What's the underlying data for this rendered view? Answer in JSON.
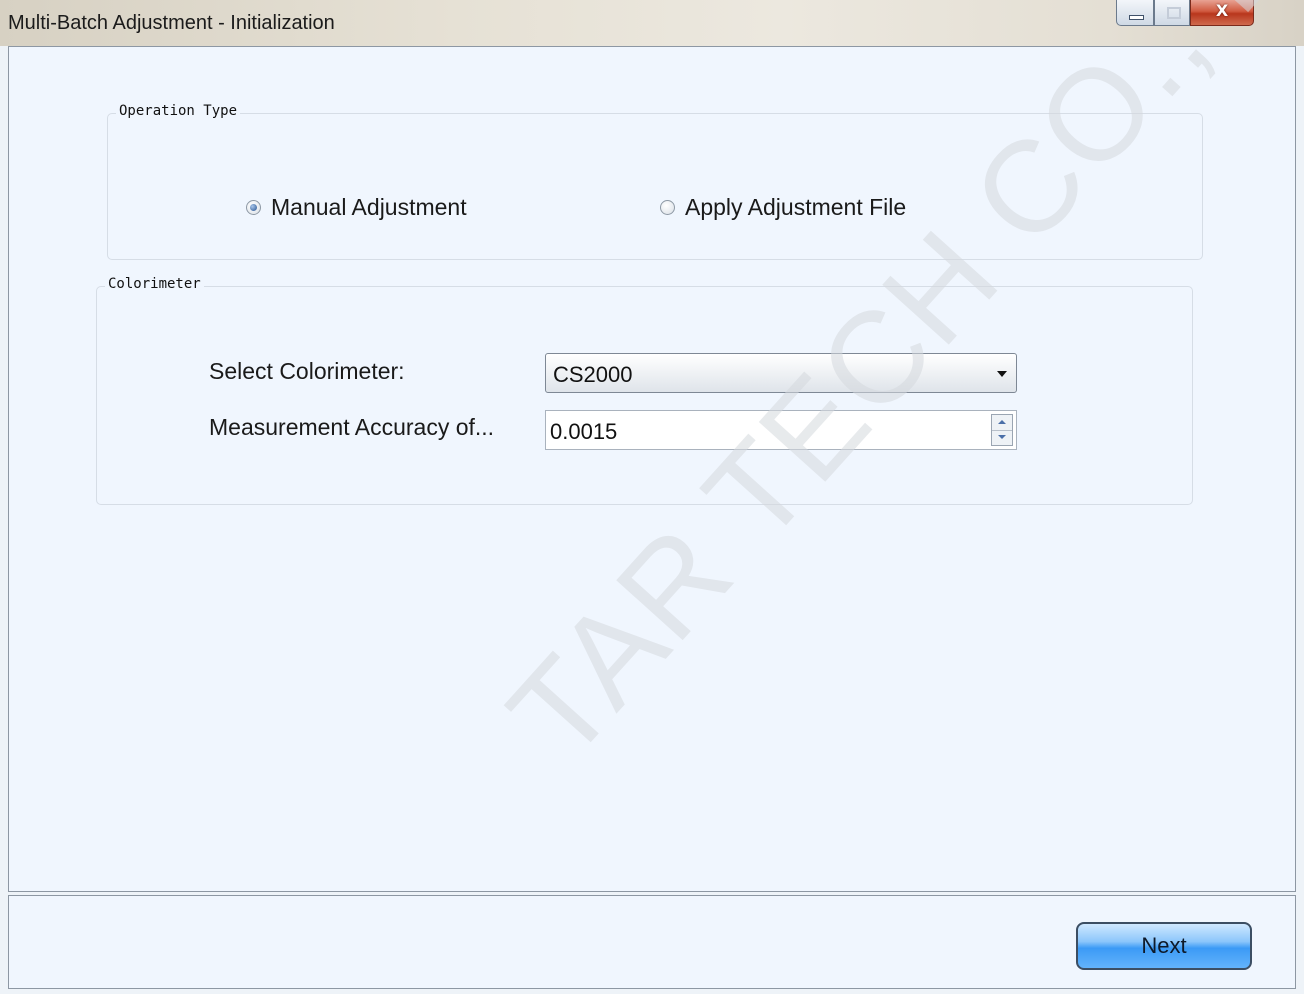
{
  "window": {
    "title": "Multi-Batch Adjustment - Initialization",
    "controls": {
      "minimize_icon": "minimize-icon",
      "maximize_icon": "maximize-icon",
      "close_glyph": "X"
    }
  },
  "operation_type": {
    "legend": "Operation Type",
    "options": [
      {
        "label": "Manual Adjustment",
        "checked": true
      },
      {
        "label": "Apply Adjustment File",
        "checked": false
      }
    ]
  },
  "colorimeter": {
    "legend": "Colorimeter",
    "select_label": "Select Colorimeter:",
    "select_value": "CS2000",
    "accuracy_label": "Measurement Accuracy of...",
    "accuracy_value": "0.0015"
  },
  "footer": {
    "next_label": "Next"
  },
  "watermark": "TAR TECH CO., LT",
  "colors": {
    "client_bg": "#f0f6fe",
    "accent": "#3b9af6",
    "close_red": "#c44a30"
  }
}
